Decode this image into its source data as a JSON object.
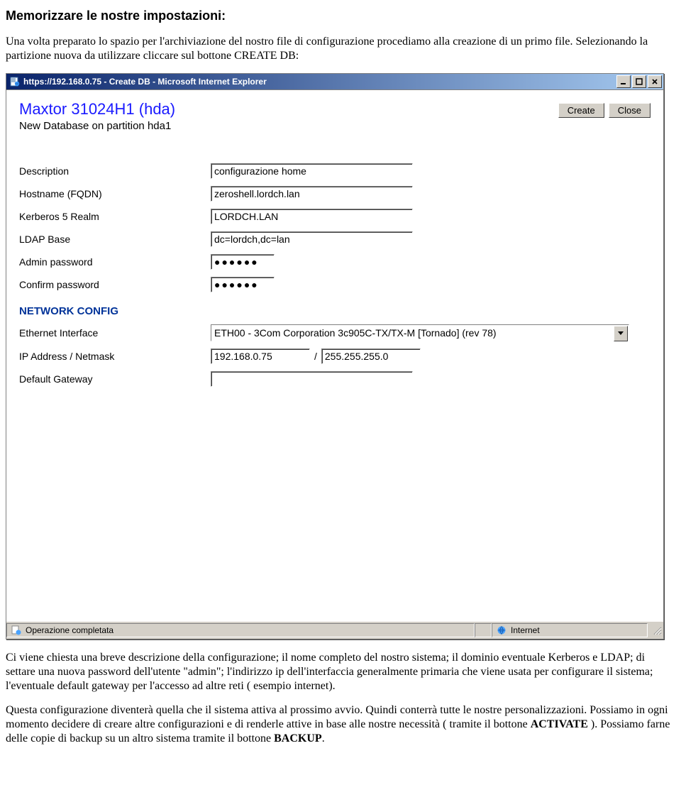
{
  "doc": {
    "heading": "Memorizzare le nostre impostazioni:",
    "para1": "Una volta preparato lo spazio per l'archiviazione del nostro file di configurazione procediamo alla creazione di un primo file. Selezionando la partizione nuova da utilizzare cliccare sul bottone CREATE DB:",
    "para2_a": "Ci viene chiesta una breve descrizione della configurazione; il nome completo del nostro sistema; il dominio eventuale Kerberos e LDAP; di settare una nuova password dell'utente \"admin\"; l'indirizzo ip dell'interfaccia generalmente primaria che viene usata per configurare il sistema; l'eventuale default gateway per l'accesso ad altre reti ( esempio internet).",
    "para3_a": "Questa configurazione diventerà quella che il sistema attiva al prossimo avvio. Quindi conterrà tutte le nostre personalizzazioni. Possiamo in ogni momento decidere di creare altre configurazioni e di renderle attive in base alle nostre necessità ( tramite il bottone ",
    "para3_bold1": "ACTIVATE",
    "para3_b": " ). Possiamo farne delle copie di backup su un altro sistema tramite il bottone ",
    "para3_bold2": "BACKUP",
    "para3_c": "."
  },
  "window": {
    "title": "https://192.168.0.75 - Create DB - Microsoft Internet Explorer",
    "disk_title": "Maxtor 31024H1 (hda)",
    "subtitle": "New Database on partition hda1",
    "btn_create": "Create",
    "btn_close": "Close",
    "labels": {
      "description": "Description",
      "hostname": "Hostname (FQDN)",
      "realm": "Kerberos 5 Realm",
      "ldap": "LDAP Base",
      "admin_pw": "Admin password",
      "confirm_pw": "Confirm password",
      "network_hdr": "NETWORK CONFIG",
      "eth": "Ethernet Interface",
      "ip": "IP Address / Netmask",
      "gw": "Default Gateway"
    },
    "values": {
      "description": "configurazione home",
      "hostname": "zeroshell.lordch.lan",
      "realm": "LORDCH.LAN",
      "ldap": "dc=lordch,dc=lan",
      "admin_pw": "●●●●●●",
      "confirm_pw": "●●●●●●",
      "eth": "ETH00 - 3Com Corporation 3c905C-TX/TX-M [Tornado] (rev 78)",
      "ip": "192.168.0.75",
      "netmask": "255.255.255.0",
      "gw": "",
      "slash": "/"
    },
    "status_left": "Operazione completata",
    "status_right": "Internet"
  }
}
